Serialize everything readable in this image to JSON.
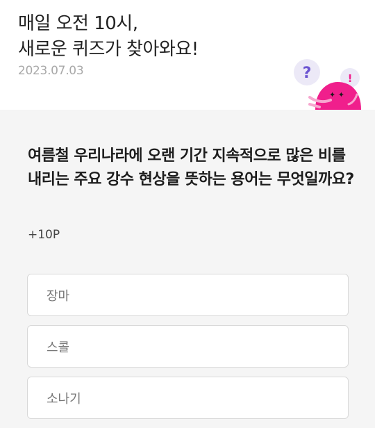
{
  "header": {
    "headline_line1": "매일 오전 10시,",
    "headline_line2": "새로운 퀴즈가 찾아와요!",
    "date": "2023.07.03",
    "mascot_colors": {
      "body": "#f01f8c",
      "bubble": "#ece9f7",
      "question_mark": "#6c55d1"
    },
    "mascot_bubble1": "?",
    "mascot_bubble2": "!"
  },
  "quiz": {
    "question": "여름철 우리나라에 오랜 기간 지속적으로 많은 비를 내리는 주요 강수 현상을 뜻하는 용어는 무엇일까요?",
    "reward": "+10P",
    "options": [
      "장마",
      "스콜",
      "소나기"
    ]
  }
}
